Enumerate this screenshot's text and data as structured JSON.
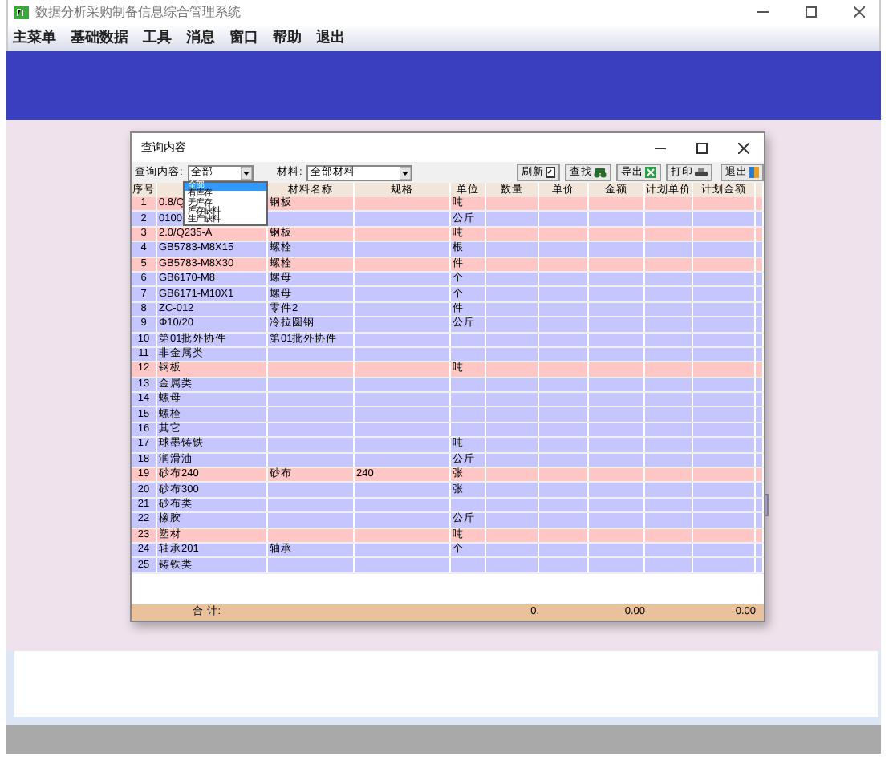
{
  "window": {
    "title": "数据分析采购制备信息综合管理系统"
  },
  "menu": [
    "主菜单",
    "基础数据",
    "工具",
    "消息",
    "窗口",
    "帮助",
    "退出"
  ],
  "dialog": {
    "title": "查询内容",
    "query": {
      "label": "查询内容:",
      "value": "全部",
      "options": [
        {
          "label": "全部",
          "selected": true
        },
        {
          "label": "有库存",
          "selected": false
        },
        {
          "label": "无库存",
          "selected": false
        },
        {
          "label": "库存缺料",
          "selected": false
        },
        {
          "label": "生产缺料",
          "selected": false
        }
      ]
    },
    "material": {
      "label": "材料:",
      "value": "全部材料"
    },
    "buttons": [
      {
        "label": "刷新",
        "kind": "refresh"
      },
      {
        "label": "查找",
        "kind": "find"
      },
      {
        "label": "导出",
        "kind": "export"
      },
      {
        "label": "打印",
        "kind": "print"
      },
      {
        "label": "退出",
        "kind": "exit"
      }
    ],
    "columns": [
      "序号",
      "",
      "材料名称",
      "规格",
      "单位",
      "数量",
      "单价",
      "金额",
      "计划单价",
      "计划金额"
    ],
    "rows": [
      {
        "cells": [
          "1",
          "0.8/Q",
          "钢板",
          "",
          "吨"
        ],
        "color": "#ffc6c6"
      },
      {
        "cells": [
          "2",
          "0100",
          "",
          "",
          "公斤"
        ],
        "color": "#c6c6ff"
      },
      {
        "cells": [
          "3",
          "2.0/Q235-A",
          "钢板",
          "",
          "吨"
        ],
        "color": "#ffc6c6"
      },
      {
        "cells": [
          "4",
          "GB5783-M8X15",
          "螺栓",
          "",
          "根"
        ],
        "color": "#c6c6ff"
      },
      {
        "cells": [
          "5",
          "GB5783-M8X30",
          "螺栓",
          "",
          "件"
        ],
        "color": "#ffc6c6"
      },
      {
        "cells": [
          "6",
          "GB6170-M8",
          "螺母",
          "",
          "个"
        ],
        "color": "#c6c6ff"
      },
      {
        "cells": [
          "7",
          "GB6171-M10X1",
          "螺母",
          "",
          "个"
        ],
        "color": "#c6c6ff"
      },
      {
        "cells": [
          "8",
          "ZC-012",
          "零件2",
          "",
          "件"
        ],
        "color": "#c6c6ff"
      },
      {
        "cells": [
          "9",
          "Φ10/20",
          "冷拉圆钢",
          "",
          "公斤"
        ],
        "color": "#c6c6ff"
      },
      {
        "cells": [
          "10",
          "第01批外协件",
          "第01批外协件",
          "",
          ""
        ],
        "color": "#c6c6ff"
      },
      {
        "cells": [
          "11",
          "非金属类",
          "",
          "",
          ""
        ],
        "color": "#c6c6ff"
      },
      {
        "cells": [
          "12",
          "钢板",
          "",
          "",
          "吨"
        ],
        "color": "#ffc6c6"
      },
      {
        "cells": [
          "13",
          "金属类",
          "",
          "",
          ""
        ],
        "color": "#c6c6ff"
      },
      {
        "cells": [
          "14",
          "螺母",
          "",
          "",
          ""
        ],
        "color": "#c6c6ff"
      },
      {
        "cells": [
          "15",
          "螺栓",
          "",
          "",
          ""
        ],
        "color": "#c6c6ff"
      },
      {
        "cells": [
          "16",
          "其它",
          "",
          "",
          ""
        ],
        "color": "#c6c6ff"
      },
      {
        "cells": [
          "17",
          "球墨铸铁",
          "",
          "",
          "吨"
        ],
        "color": "#c6c6ff"
      },
      {
        "cells": [
          "18",
          "润滑油",
          "",
          "",
          "公斤"
        ],
        "color": "#c6c6ff"
      },
      {
        "cells": [
          "19",
          "砂布240",
          "砂布",
          "240",
          "张"
        ],
        "color": "#ffc6c6"
      },
      {
        "cells": [
          "20",
          "砂布300",
          "",
          "",
          "张"
        ],
        "color": "#c6c6ff"
      },
      {
        "cells": [
          "21",
          "砂布类",
          "",
          "",
          ""
        ],
        "color": "#c6c6ff"
      },
      {
        "cells": [
          "22",
          "橡胶",
          "",
          "",
          "公斤"
        ],
        "color": "#c6c6ff"
      },
      {
        "cells": [
          "23",
          "塑材",
          "",
          "",
          "吨"
        ],
        "color": "#ffc6c6"
      },
      {
        "cells": [
          "24",
          "轴承201",
          "轴承",
          "",
          "个"
        ],
        "color": "#c6c6ff"
      },
      {
        "cells": [
          "25",
          "铸铁类",
          "",
          "",
          ""
        ],
        "color": "#c6c6ff"
      }
    ],
    "totals": {
      "label": "合  计:",
      "quantity": "0.",
      "amount": "0.00",
      "plan_amount": "0.00"
    }
  }
}
